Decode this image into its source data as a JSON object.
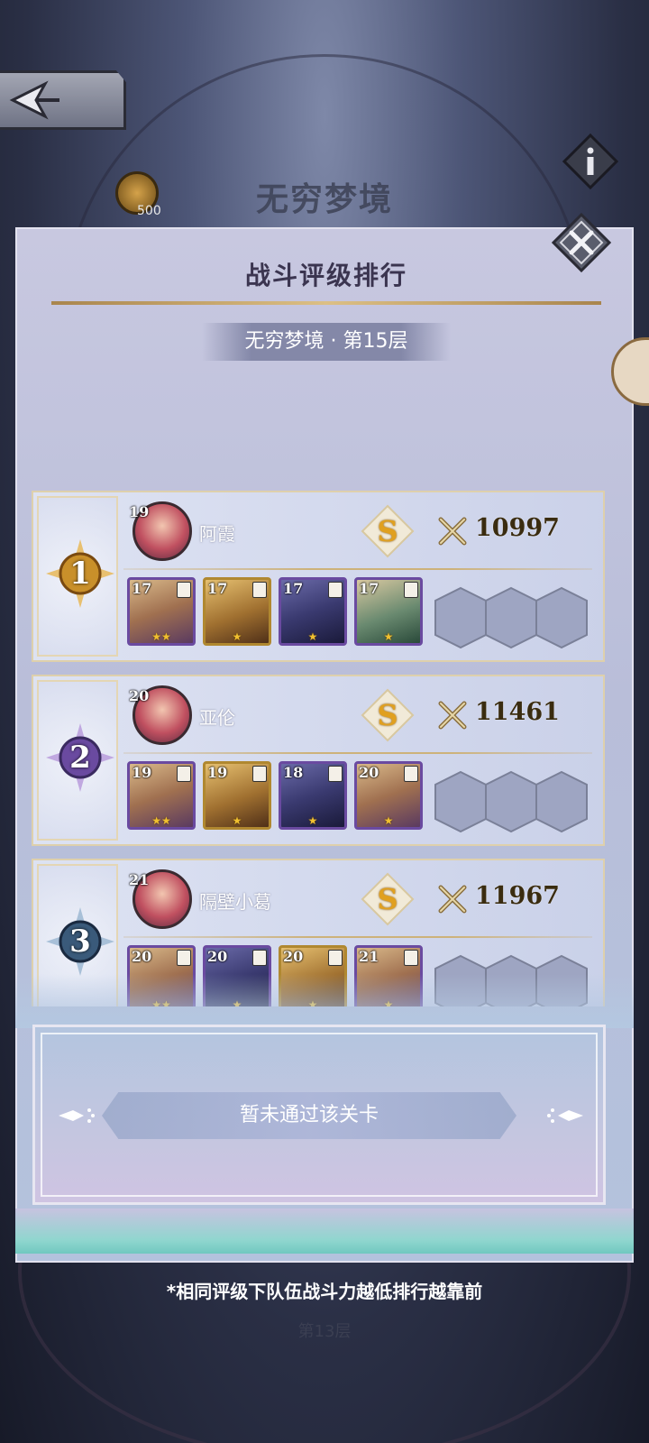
{
  "background": {
    "title": "无穷梦境",
    "coin_count": "500",
    "floor_label": "第13层",
    "footnote": "*相同评级下队伍战斗力越低排行越靠前"
  },
  "panel": {
    "title": "战斗评级排行",
    "subtitle": "无穷梦境 · 第15层"
  },
  "rankings": [
    {
      "rank": "1",
      "avatar_level": "19",
      "name": "阿霞",
      "grade": "S",
      "power": "10997",
      "heroes": [
        {
          "level": "17",
          "stars": "★★",
          "style": "purple"
        },
        {
          "level": "17",
          "stars": "★",
          "style": "gold"
        },
        {
          "level": "17",
          "stars": "★",
          "style": "blue"
        },
        {
          "level": "17",
          "stars": "★",
          "style": "green"
        }
      ]
    },
    {
      "rank": "2",
      "avatar_level": "20",
      "name": "亚伦",
      "grade": "S",
      "power": "11461",
      "heroes": [
        {
          "level": "19",
          "stars": "★★",
          "style": "purple"
        },
        {
          "level": "19",
          "stars": "★",
          "style": "gold"
        },
        {
          "level": "18",
          "stars": "★",
          "style": "blue"
        },
        {
          "level": "20",
          "stars": "★",
          "style": "purple"
        }
      ]
    },
    {
      "rank": "3",
      "avatar_level": "21",
      "name": "隔壁小葛",
      "grade": "S",
      "power": "11967",
      "heroes": [
        {
          "level": "20",
          "stars": "★★",
          "style": "purple"
        },
        {
          "level": "20",
          "stars": "★",
          "style": "blue"
        },
        {
          "level": "20",
          "stars": "★",
          "style": "gold"
        },
        {
          "level": "21",
          "stars": "★",
          "style": "purple"
        }
      ]
    }
  ],
  "my_rank": {
    "status": "暂未通过该关卡"
  },
  "colors": {
    "rank1": "#c9902a",
    "rank2": "#6a4aa0",
    "rank3": "#3a5a7a",
    "grade": "#e0a020"
  },
  "icons": [
    "back-arrow-icon",
    "info-icon",
    "close-icon",
    "crossed-swords-icon",
    "coin-icon"
  ]
}
